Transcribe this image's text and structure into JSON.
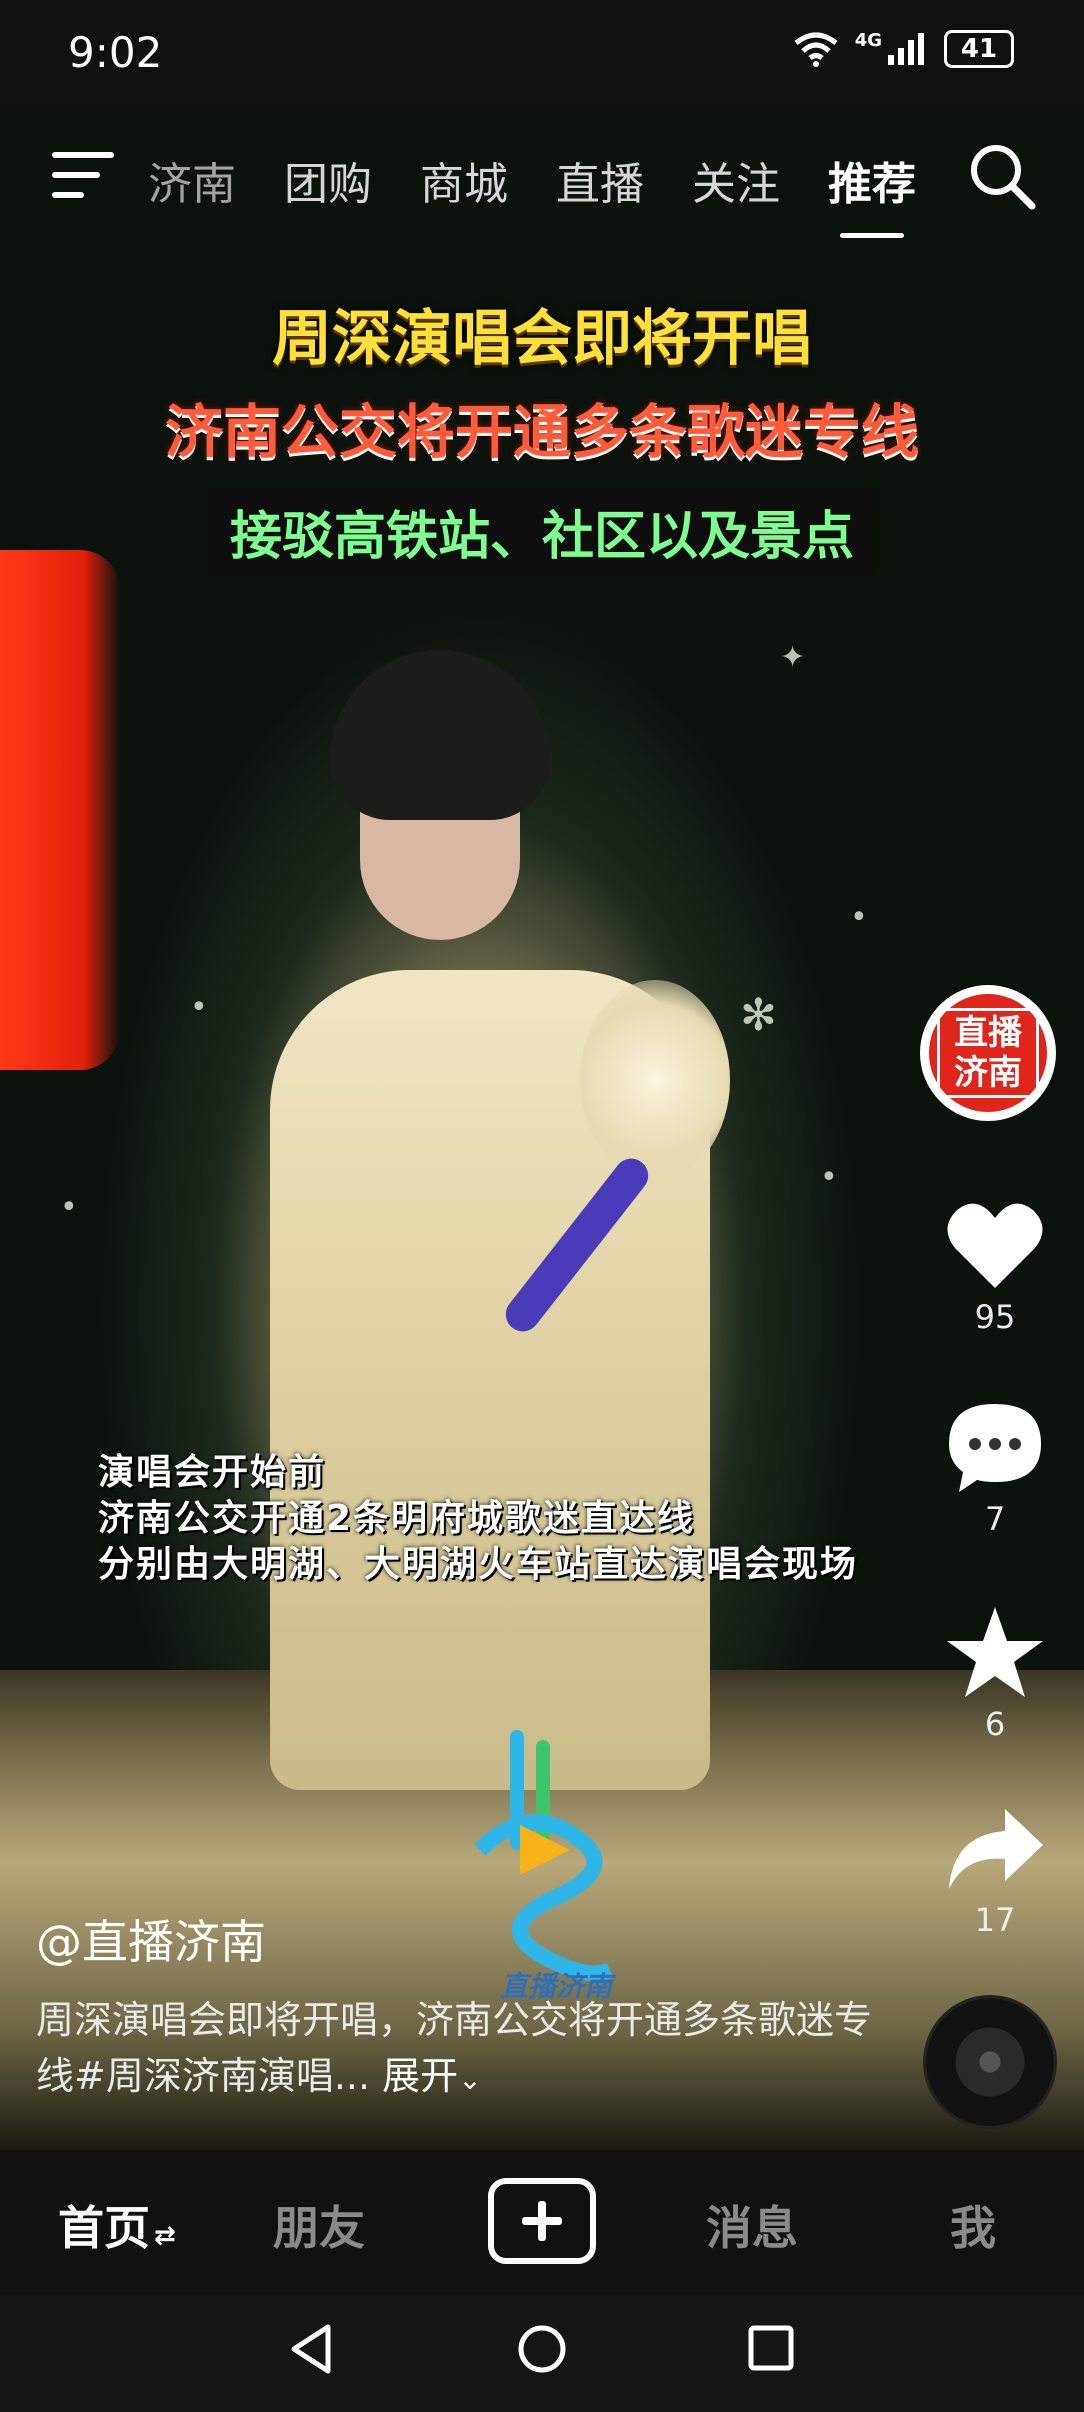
{
  "status_bar": {
    "time": "9:02",
    "network": "4G",
    "battery": "41"
  },
  "top_nav": {
    "tabs": [
      "济南",
      "团购",
      "商城",
      "直播",
      "关注",
      "推荐"
    ],
    "active_tab": "推荐"
  },
  "video": {
    "headline_1": "周深演唱会即将开唱",
    "headline_2": "济南公交将开通多条歌迷专线",
    "headline_3": "接驳高铁站、社区以及景点",
    "subtitle_lines": [
      "演唱会开始前",
      "济南公交开通2条明府城歌迷直达线",
      "分别由大明湖、大明湖火车站直达演唱会现场"
    ],
    "logo_text": "直播济南"
  },
  "right_rail": {
    "avatar_text": "直播济南",
    "likes": "95",
    "comments": "7",
    "favorites": "6",
    "shares": "17"
  },
  "post": {
    "author": "@直播济南",
    "description": "周深演唱会即将开唱，济南公交将开通多条歌迷专线#周深济南演唱...",
    "expand_label": "展开"
  },
  "bottom_tabs": {
    "home": "首页",
    "friends": "朋友",
    "messages": "消息",
    "me": "我"
  },
  "colors": {
    "headline_1": "#ffe03a",
    "headline_2": "#ff5a3a",
    "headline_3": "#7dff8f"
  }
}
